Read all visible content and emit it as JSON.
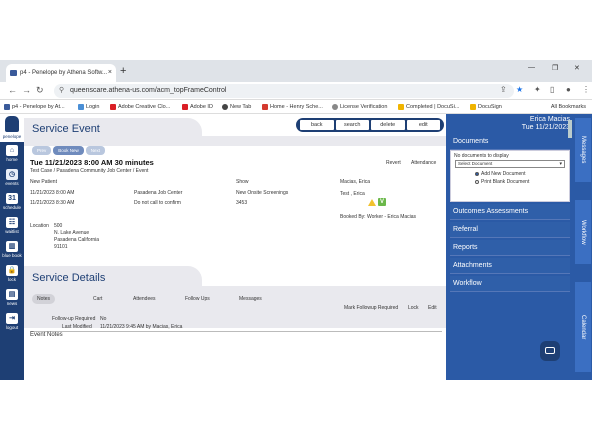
{
  "browser": {
    "tab_title": "p4 - Penelope by Athena Softw...",
    "url": "queenscare.athena-us.com/acm_topFrameControl",
    "bookmarks": [
      "p4 - Penelope by At...",
      "Login",
      "Adobe Creative Clo...",
      "Adobe ID",
      "New Tab",
      "Home - Henry Sche...",
      "License Verification",
      "Completed | DocuSi...",
      "DocuSign"
    ],
    "all_bookmarks": "All Bookmarks"
  },
  "leftnav": {
    "logo_label": "penelope",
    "items": [
      "home",
      "events",
      "schedule",
      "waitlist",
      "blue book",
      "lock",
      "news",
      "logout"
    ]
  },
  "service_event": {
    "title": "Service Event",
    "actions": [
      "back",
      "search",
      "delete",
      "edit"
    ],
    "mini_buttons": [
      "Prev",
      "Book New",
      "Next"
    ],
    "event_title": "Tue 11/21/2023 8:00 AM   30 minutes",
    "event_subtitle": "Test Case / Pasadena Community Job Center / Event",
    "revert": "Revert",
    "attendance": "Attendance",
    "col_new_patient": "New Patient",
    "col_show": "Show",
    "staff_name": "Macias, Erica",
    "row1": {
      "time": "11/21/2023 8:00 AM",
      "place": "Pasadena Job Center",
      "type": "New Onsite Screenings"
    },
    "row2": {
      "time": "11/21/2023 8:30 AM",
      "place": "Do not call to confirm",
      "num": "3453"
    },
    "client": "Test , Erica",
    "booked_by": "Booked By: Worker - Erica Macias",
    "location_label": "Location",
    "location_lines": [
      "500",
      "N. Lake Avenue",
      "Pasadena California",
      "91101"
    ]
  },
  "service_details": {
    "title": "Service Details",
    "tabs": [
      "Notes",
      "Cart",
      "Attendees",
      "Follow Ups",
      "Messages"
    ],
    "actions": [
      "Mark Followup Required",
      "Lock",
      "Edit"
    ],
    "followup_label": "Follow-up Required",
    "followup_value": "No",
    "modified_label": "Last Modified",
    "modified_value": "11/21/2023 9:45 AM by Macias, Erica",
    "event_notes": "Event Notes"
  },
  "right_panel": {
    "user_name": "Erica Macias",
    "date": "Tue 11/21/2023",
    "documents_title": "Documents",
    "no_docs": "No documents to display",
    "select_placeholder": "Select Document",
    "radio_add": "Add New Document",
    "radio_print": "Print Blank Document",
    "sections": [
      "Outcomes Assessments",
      "Referral",
      "Reports",
      "Attachments",
      "Workflow"
    ],
    "vertical_tabs": [
      "Messages",
      "Workflow",
      "Calendar"
    ]
  },
  "colors": {
    "navy": "#1e3f74",
    "panel_blue": "#2b5aa6",
    "panel_bg": "#e9e9ee"
  }
}
